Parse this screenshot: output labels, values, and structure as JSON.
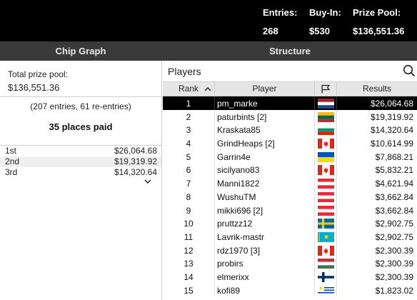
{
  "header": {
    "entries_label": "Entries:",
    "entries_value": "268",
    "buyin_label": "Buy-In:",
    "buyin_value": "$530",
    "prizepool_label": "Prize Pool:",
    "prizepool_value": "$136,551.36"
  },
  "tabs": [
    {
      "label": "Chip Graph"
    },
    {
      "label": "Structure"
    }
  ],
  "summary": {
    "total_prize_label": "Total prize pool:",
    "total_prize_value": "$136,551.36",
    "entries_text": "(207 entries, 61 re-entries)",
    "places_paid": "35 places paid",
    "payouts": [
      {
        "place": "1st",
        "amount": "$26,064.68"
      },
      {
        "place": "2nd",
        "amount": "$19,319.92"
      },
      {
        "place": "3rd",
        "amount": "$14,320.64"
      }
    ],
    "expand_icon": "chevron-down-icon"
  },
  "players": {
    "title": "Players",
    "search_icon": "search-icon",
    "columns": {
      "rank": "Rank",
      "player": "Player",
      "flag_icon": "flag-outline-icon",
      "results": "Results"
    },
    "selected_row": 0,
    "rows": [
      {
        "rank": "1",
        "name": "pm_marke",
        "flag": "netherlands-flag-icon",
        "result": "$26,064.68"
      },
      {
        "rank": "2",
        "name": "paturbints [2]",
        "flag": "lithuania-flag-icon",
        "result": "$19,319.92"
      },
      {
        "rank": "3",
        "name": "Kraskata85",
        "flag": "bulgaria-flag-icon",
        "result": "$14,320.64"
      },
      {
        "rank": "4",
        "name": "GrindHeaps [2]",
        "flag": "canada-flag-icon",
        "result": "$10,614.99"
      },
      {
        "rank": "5",
        "name": "Garrin4e",
        "flag": "ukraine-flag-icon",
        "result": "$7,868.21"
      },
      {
        "rank": "6",
        "name": "sicilyano83",
        "flag": "canada-flag-icon",
        "result": "$5,832.21"
      },
      {
        "rank": "7",
        "name": "Manni1822",
        "flag": "austria-flag-icon",
        "result": "$4,621.94"
      },
      {
        "rank": "8",
        "name": "WushuTM",
        "flag": "austria-flag-icon",
        "result": "$3,662.84"
      },
      {
        "rank": "9",
        "name": "mikki696 [2]",
        "flag": "austria-flag-icon",
        "result": "$3,662.84"
      },
      {
        "rank": "10",
        "name": "pruttzz12",
        "flag": "sweden-flag-icon",
        "result": "$2,902.75"
      },
      {
        "rank": "11",
        "name": "Lavrik-mastr",
        "flag": "kazakhstan-flag-icon",
        "result": "$2,902.75"
      },
      {
        "rank": "12",
        "name": "rdz1970 [3]",
        "flag": "canada-flag-icon",
        "result": "$2,300.39"
      },
      {
        "rank": "13",
        "name": "probirs",
        "flag": "hungary-flag-icon",
        "result": "$2,300.39"
      },
      {
        "rank": "14",
        "name": "elmerixx",
        "flag": "finland-flag-icon",
        "result": "$2,300.39"
      },
      {
        "rank": "15",
        "name": "kofi89",
        "flag": "uruguay-flag-icon",
        "result": "$1,823.02"
      }
    ]
  },
  "colors": {
    "header_bg": "#000000",
    "tab_bg": "#3a3a3a",
    "selected_row_bg": "#000000",
    "table_head_bg": "#e6e6e6"
  }
}
